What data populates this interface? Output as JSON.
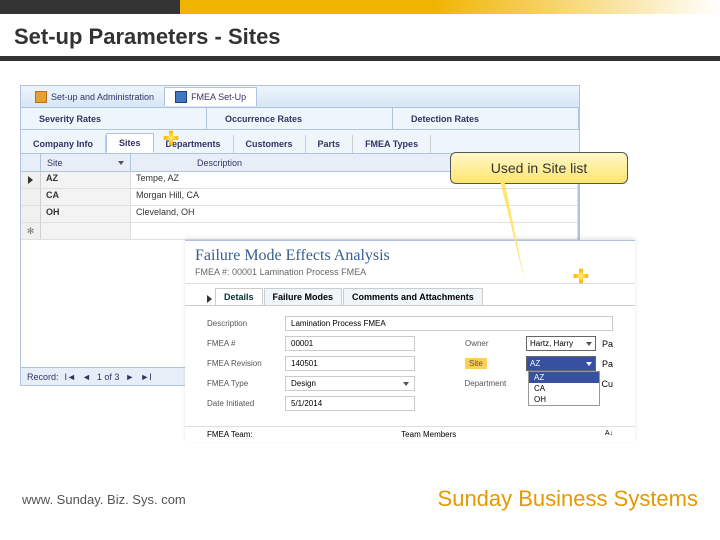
{
  "page": {
    "title": "Set-up Parameters - Sites"
  },
  "callout": {
    "text": "Used in Site list"
  },
  "setup": {
    "top_tabs": {
      "admin": "Set-up and Administration",
      "fmea": "FMEA Set-Up"
    },
    "rate_tabs": {
      "severity": "Severity Rates",
      "occurrence": "Occurrence Rates",
      "detection": "Detection Rates"
    },
    "level2": {
      "company": "Company Info",
      "sites": "Sites",
      "departments": "Departments",
      "customers": "Customers",
      "parts": "Parts",
      "fmea_types": "FMEA Types"
    },
    "grid_headers": {
      "site": "Site",
      "description": "Description"
    },
    "rows": [
      {
        "code": "AZ",
        "desc": "Tempe, AZ"
      },
      {
        "code": "CA",
        "desc": "Morgan Hill, CA"
      },
      {
        "code": "OH",
        "desc": "Cleveland, OH"
      }
    ],
    "record_nav": {
      "label": "Record:",
      "pos": "1 of 3"
    }
  },
  "fmea": {
    "title": "Failure Mode Effects Analysis",
    "subtitle_label": "FMEA #:",
    "subtitle_num": "00001",
    "subtitle_name": "Lamination Process FMEA",
    "tabs": {
      "details": "Details",
      "failure_modes": "Failure Modes",
      "comments": "Comments and Attachments"
    },
    "fields": {
      "description_label": "Description",
      "description_value": "Lamination Process FMEA",
      "num_label": "FMEA #",
      "num_value": "00001",
      "rev_label": "FMEA Revision",
      "rev_value": "140501",
      "type_label": "FMEA Type",
      "type_value": "Design",
      "date_label": "Date Initiated",
      "date_value": "5/1/2014",
      "owner_label": "Owner",
      "owner_value": "Hartz, Harry",
      "site_label": "Site",
      "site_value": "AZ",
      "dept_label": "Department",
      "pa_suffix": "Pa",
      "cu_suffix": "Cu"
    },
    "site_options": [
      "AZ",
      "CA",
      "OH"
    ],
    "team_label": "FMEA Team:",
    "team_col_header": "Team Members"
  },
  "footer": {
    "url": "www. Sunday. Biz. Sys. com",
    "brand": "Sunday Business Systems"
  }
}
